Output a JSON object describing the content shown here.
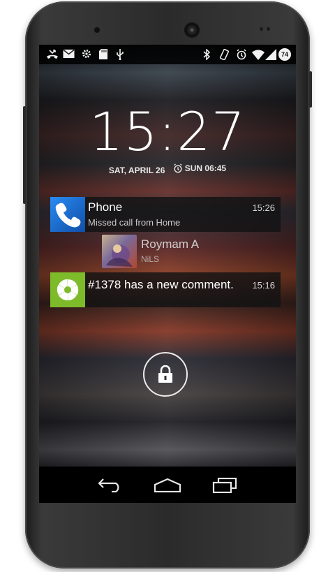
{
  "status_bar": {
    "left_icons": [
      "missed-call-icon",
      "gmail-icon",
      "settings-icon",
      "sd-card-icon",
      "usb-icon"
    ],
    "right_icons": [
      "bluetooth-icon",
      "vibrate-icon",
      "alarm-icon",
      "wifi-icon",
      "signal-icon"
    ],
    "battery_level": "74"
  },
  "lockscreen": {
    "time": "15:27",
    "date": "SAT, APRIL 26",
    "alarm": "SUN 06:45"
  },
  "notifications": [
    {
      "app": "Phone",
      "title": "Phone",
      "text": "Missed call from Home",
      "time": "15:26",
      "icon": "phone-icon",
      "accent": "#1f6fd6"
    },
    {
      "title": "Roymam A",
      "text": "NiLS",
      "icon": "avatar"
    },
    {
      "title": "#1378 has a new comment.",
      "time": "15:16",
      "icon": "app-logo-icon",
      "accent": "#7dbb2b"
    }
  ],
  "nav": {
    "back": "back-icon",
    "home": "home-icon",
    "recents": "recents-icon"
  }
}
